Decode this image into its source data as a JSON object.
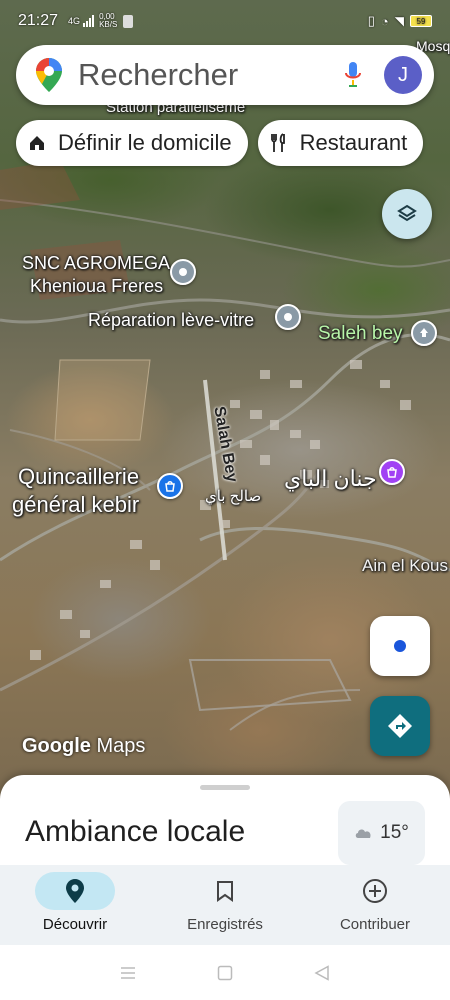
{
  "status_bar": {
    "time": "21:27",
    "network": "4G",
    "speed_value": "0,00",
    "speed_unit": "KB/S",
    "battery": "59"
  },
  "search": {
    "placeholder": "Rechercher"
  },
  "account": {
    "initial": "J"
  },
  "chips": {
    "home_label": "Définir le domicile",
    "restaurants_label": "Restaurant"
  },
  "map": {
    "labels": {
      "mosque_partial": "Mosq",
      "station_partial": "Station paralleliseme",
      "snc_line1": "SNC AGROMEGA",
      "snc_line2": "Khenioua Freres",
      "reparation": "Réparation lève-vitre",
      "saleh_bey": "Saleh bey",
      "quincaillerie_line1": "Quincaillerie",
      "quincaillerie_line2": "général kebir",
      "salah_bey_road": "Salah Bey",
      "salah_bey_arabic": "صالح باي",
      "jnan_bey_arabic": "جنان الباي",
      "ain_el_kous": "Ain el Kous"
    },
    "attribution": {
      "google": "Google",
      "maps": "Maps"
    }
  },
  "sheet": {
    "title": "Ambiance locale",
    "temperature": "15°"
  },
  "bottom_nav": {
    "items": [
      {
        "label": "Découvrir",
        "icon": "location-pin-icon",
        "active": true
      },
      {
        "label": "Enregistrés",
        "icon": "bookmark-icon",
        "active": false
      },
      {
        "label": "Contribuer",
        "icon": "add-circle-icon",
        "active": false
      }
    ]
  },
  "colors": {
    "avatar": "#5b5fc7",
    "directions": "#0f6e7e",
    "layers_bg": "#cbe6ee",
    "active_nav_pill": "#c3e7f3",
    "pin_blue": "#1a73e8",
    "pin_grey": "#8a9aa6",
    "pin_purple": "#a142f4",
    "location_dot": "#1a56db"
  }
}
